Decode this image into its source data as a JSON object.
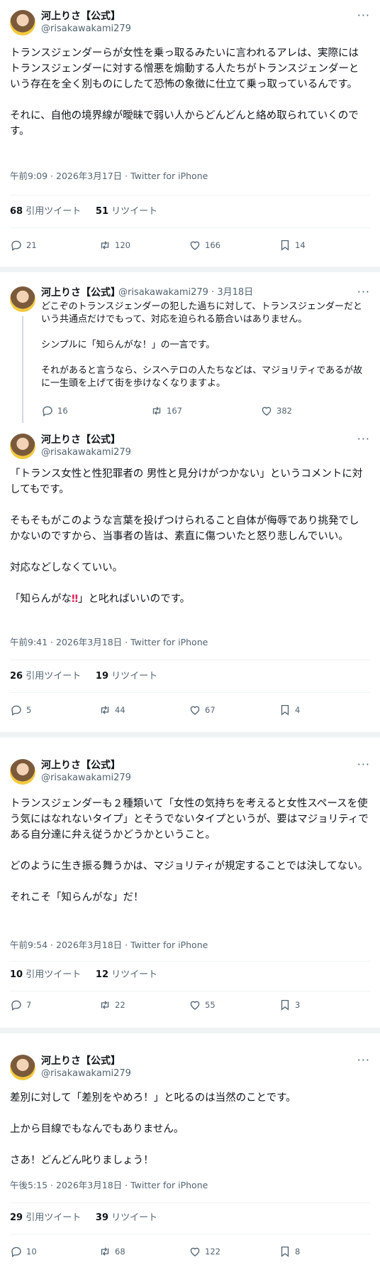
{
  "user": {
    "name": "河上りさ【公式】",
    "handle": "@risakawakami279",
    "more": "···"
  },
  "tweets": [
    {
      "body": "トランスジェンダーらが女性を乗っ取るみたいに言われるアレは、実際にはトランスジェンダーに対する憎悪を煽動する人たちがトランスジェンダーという存在を全く別ものにしたて恐怖の象徴に仕立て乗っ取っているんです。\n\nそれに、自他の境界線が曖昧で弱い人からどんどんと絡め取られていくのです。",
      "meta": "午前9:09 · 2026年3月17日 · Twitter for iPhone",
      "quotes": "68",
      "quotes_label": "引用ツイート",
      "retweets": "51",
      "retweets_label": "リツイート",
      "replies": "21",
      "rts": "120",
      "likes": "166",
      "bookmarks": "14"
    },
    {
      "date": "· 3月18日",
      "body": "どこぞのトランスジェンダーの犯した過ちに対して、トランスジェンダーだという共通点だけでもって、対応を迫られる筋合いはありません。\n\nシンプルに「知らんがな！」の一言です。\n\nそれがあると言うなら、シスヘテロの人たちなどは、マジョリティであるが故に一生頭を上げて街を歩けなくなりますよ。",
      "replies": "16",
      "rts": "167",
      "likes": "382"
    },
    {
      "body_a": "「トランス女性と性犯罪者の 男性と見分けがつかない」というコメントに対してもです。\n\nそもそもがこのような言葉を投げつけられること自体が侮辱であり挑発でしかないのですから、当事者の皆は、素直に傷ついたと怒り悲しんでいい。\n\n対応などしなくていい。\n\n",
      "body_b": "「知らんがな",
      "body_mark": "‼",
      "body_c": "」と叱ればいいのです。",
      "meta": "午前9:41 · 2026年3月18日 · Twitter for iPhone",
      "quotes": "26",
      "quotes_label": "引用ツイート",
      "retweets": "19",
      "retweets_label": "リツイート",
      "replies": "5",
      "rts": "44",
      "likes": "67",
      "bookmarks": "4"
    },
    {
      "body": "トランスジェンダーも２種類いて「女性の気持ちを考えると女性スペースを使う気にはなれないタイプ」とそうでないタイプというが、要はマジョリティである自分達に弁え従うかどうかということ。\n\nどのように生き振る舞うかは、マジョリティが規定することでは決してない。\n\nそれこそ「知らんがな」だ！",
      "meta": "午前9:54 · 2026年3月18日 · Twitter for iPhone",
      "quotes": "10",
      "quotes_label": "引用ツイート",
      "retweets": "12",
      "retweets_label": "リツイート",
      "replies": "7",
      "rts": "22",
      "likes": "55",
      "bookmarks": "3"
    },
    {
      "body": "差別に対して「差別をやめろ！」と叱るのは当然のことです。\n\n上から目線でもなんでもありません。\n\nさあ！どんどん叱りましょう！",
      "meta": "午後5:15 · 2026年3月18日 · Twitter for iPhone",
      "quotes": "29",
      "quotes_label": "引用ツイート",
      "retweets": "39",
      "retweets_label": "リツイート",
      "replies": "10",
      "rts": "68",
      "likes": "122",
      "bookmarks": "8"
    }
  ],
  "icons": {
    "reply": "reply-icon",
    "retweet": "retweet-icon",
    "like": "like-icon",
    "bookmark": "bookmark-icon"
  },
  "colors": {
    "accent": "#1d9bf0",
    "muted": "#536471",
    "divider": "#eff3f4",
    "emphasis": "#e0245e"
  }
}
